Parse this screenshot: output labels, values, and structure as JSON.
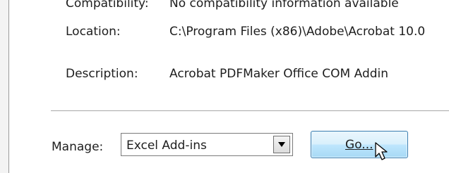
{
  "details": {
    "compatibility_label": "Compatibility:",
    "compatibility_value": "No compatibility information available",
    "location_label": "Location:",
    "location_value": "C:\\Program Files (x86)\\Adobe\\Acrobat 10.0",
    "description_label": "Description:",
    "description_value": "Acrobat PDFMaker Office COM Addin"
  },
  "manage": {
    "label": "Manage:",
    "selected": "Excel Add-ins",
    "go_label": "Go..."
  },
  "icons": {
    "dropdown": "dropdown-arrow-icon",
    "cursor": "mouse-pointer-icon"
  }
}
